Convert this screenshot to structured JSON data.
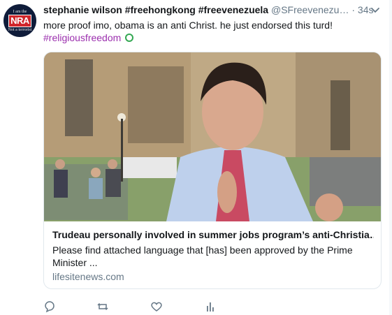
{
  "tweet": {
    "author_name": "stephanie wilson #freehongkong #freevenezuela",
    "author_handle": "@SFreevenezu…",
    "separator": "·",
    "time": "34s",
    "text": "more proof imo, obama is an anti Christ. he just endorsed this turd!",
    "hashtag": "#religiousfreedom"
  },
  "avatar": {
    "top_text": "I am the",
    "logo_text": "NRA",
    "bottom_text": "Not a terrorist"
  },
  "card": {
    "title": "Trudeau personally involved in summer jobs program’s anti-Christia…",
    "description": "Please find attached language that [has] been approved by the Prime Minister ...",
    "domain": "lifesitenews.com"
  },
  "actions": {
    "reply": "reply-icon",
    "retweet": "retweet-icon",
    "like": "heart-icon",
    "analytics": "analytics-icon"
  },
  "colors": {
    "hashtag": "#9b2fae",
    "secondary_text": "#657786",
    "brand_red": "#d0262b"
  }
}
